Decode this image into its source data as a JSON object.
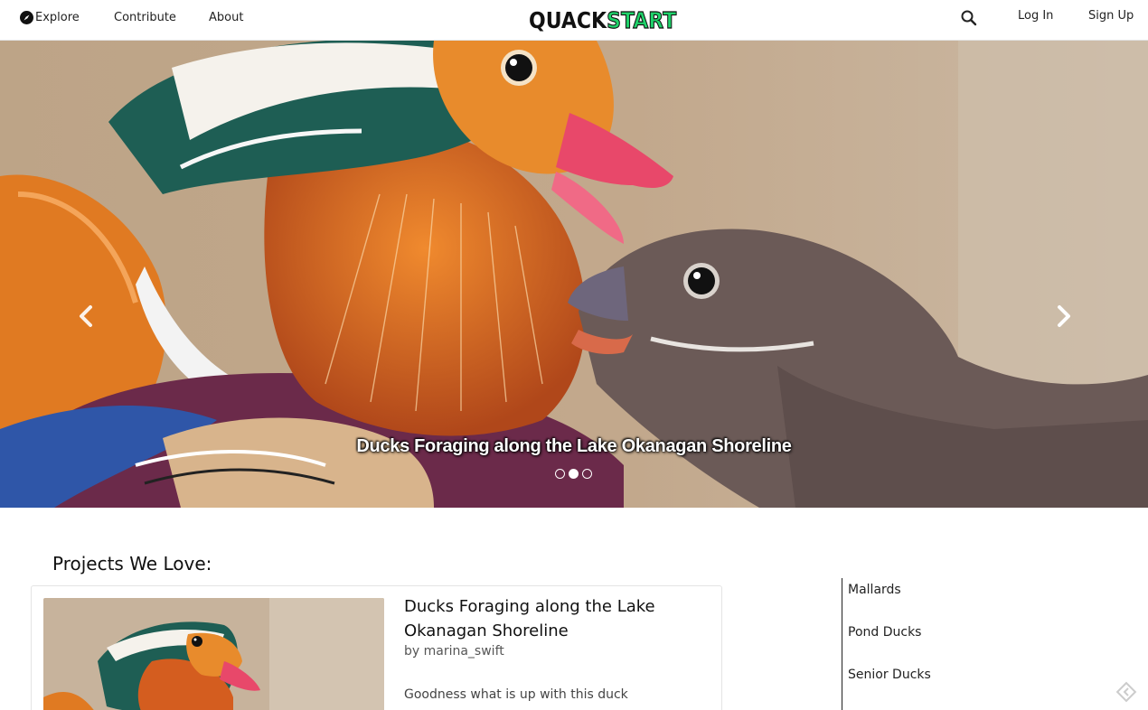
{
  "nav": {
    "explore": "Explore",
    "contribute": "Contribute",
    "about": "About",
    "logo_part1": "QUACK",
    "logo_part2": "START",
    "login": "Log In",
    "signup": "Sign Up"
  },
  "hero": {
    "caption": "Ducks Foraging along the Lake Okanagan Shoreline",
    "slides_count": 3,
    "active_slide": 2
  },
  "projects": {
    "heading": "Projects We Love:",
    "featured": {
      "title": "Ducks Foraging along the Lake Okanagan Shoreline",
      "author": "by marina_swift",
      "description": "Goodness what is up with this duck"
    }
  },
  "categories": [
    "Mallards",
    "Pond Ducks",
    "Senior Ducks"
  ],
  "colors": {
    "brand_green": "#1fd26a",
    "text": "#222222"
  },
  "icons": {
    "explore": "compass-icon",
    "search": "search-icon",
    "prev": "chevron-left-icon",
    "next": "chevron-right-icon"
  }
}
